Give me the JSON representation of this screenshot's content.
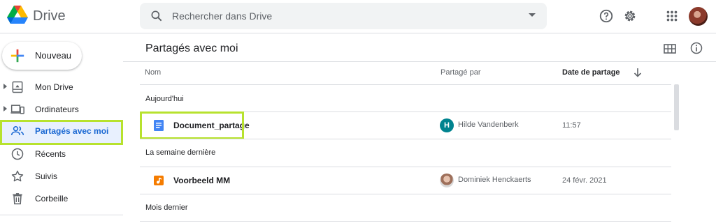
{
  "header": {
    "app_name": "Drive",
    "search_placeholder": "Rechercher dans Drive",
    "icons": [
      "drive-logo",
      "search-icon",
      "search-options-icon",
      "help-icon",
      "gear-icon",
      "apps-icon",
      "avatar"
    ]
  },
  "sidebar": {
    "new_label": "Nouveau",
    "items": [
      {
        "label": "Mon Drive",
        "icon": "my-drive-icon",
        "expandable": true
      },
      {
        "label": "Ordinateurs",
        "icon": "computers-icon",
        "expandable": true
      },
      {
        "label": "Partagés avec moi",
        "icon": "shared-icon",
        "active": true
      },
      {
        "label": "Récents",
        "icon": "clock-icon"
      },
      {
        "label": "Suivis",
        "icon": "star-icon"
      },
      {
        "label": "Corbeille",
        "icon": "trash-icon"
      }
    ]
  },
  "main": {
    "title": "Partagés avec moi",
    "columns": {
      "name": "Nom",
      "shared_by": "Partagé par",
      "date": "Date de partage"
    },
    "groups": [
      {
        "label": "Aujourd'hui"
      },
      {
        "label": "La semaine dernière"
      },
      {
        "label": "Mois dernier"
      }
    ],
    "files": [
      {
        "name": "Document_partage",
        "type": "doc-icon",
        "sharer": "Hilde Vandenberk",
        "sharer_initial": "H",
        "date": "11:57"
      },
      {
        "name": "Voorbeeld MM",
        "type": "audio-icon",
        "sharer": "Dominiek Henckaerts",
        "sharer_initial": "",
        "date": "24 févr. 2021"
      }
    ]
  },
  "colors": {
    "accent_blue": "#1967d2",
    "active_bg": "#e8f0fe",
    "highlight_green": "#b7e22e",
    "sharer_teal": "#00838f",
    "audio_orange": "#f57c00",
    "doc_blue": "#4285f4"
  }
}
